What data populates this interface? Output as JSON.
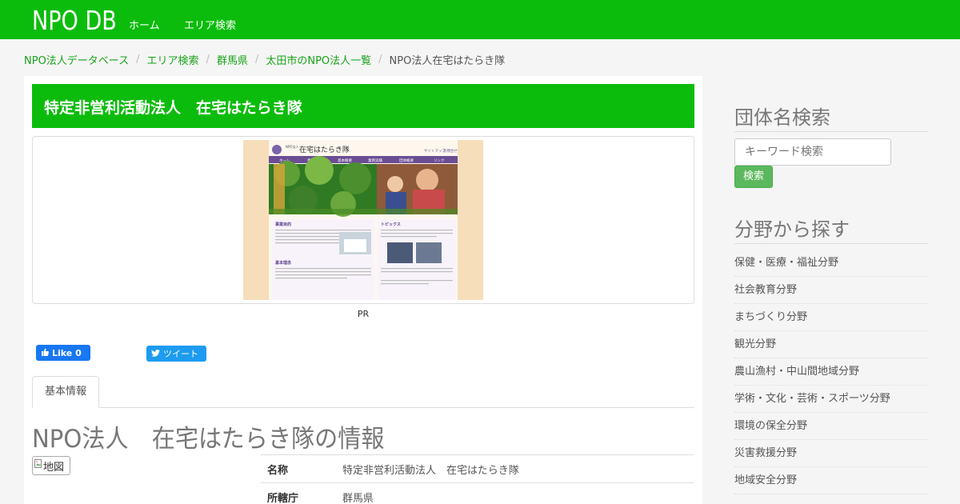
{
  "navbar": {
    "brand": "NPO DB",
    "links": [
      "ホーム",
      "エリア検索"
    ]
  },
  "breadcrumb": {
    "items": [
      "NPO法人データベース",
      "エリア検索",
      "群馬県",
      "太田市のNPO法人一覧"
    ],
    "separator": "/",
    "current": "NPO法人在宅はたらき隊"
  },
  "main": {
    "title": "特定非営利活動法人　在宅はたらき隊",
    "pr_label": "PR",
    "screenshot": {
      "logo_text": "在宅はたらき隊",
      "header_links": [
        "サイトマップ",
        "お問合せ"
      ],
      "nav": [
        "ホーム",
        "事業目的",
        "基本概要",
        "業務実績",
        "団体概要",
        "リンク"
      ],
      "section_left_1": "事業目的",
      "section_left_2": "基本理念",
      "section_right": "トピックス"
    },
    "social": {
      "like_label": "Like 0",
      "tweet_label": "ツイート"
    },
    "tabs": [
      "基本情報"
    ],
    "info_heading": "NPO法人　在宅はたらき隊の情報",
    "map_alt": "地図",
    "info_rows": [
      {
        "label": "名称",
        "value": "特定非営利活動法人　在宅はたらき隊"
      },
      {
        "label": "所轄庁",
        "value": "群馬県"
      }
    ]
  },
  "sidebar": {
    "search_heading": "団体名検索",
    "search_placeholder": "キーワード検索",
    "search_button": "検索",
    "category_heading": "分野から探す",
    "categories": [
      "保健・医療・福祉分野",
      "社会教育分野",
      "まちづくり分野",
      "観光分野",
      "農山漁村・中山間地域分野",
      "学術・文化・芸術・スポーツ分野",
      "環境の保全分野",
      "災害救援分野",
      "地域安全分野"
    ]
  },
  "colors": {
    "brand_green": "#0cbc0c",
    "link_green": "#18a318",
    "button_green": "#5cb85c",
    "facebook_blue": "#1877f2",
    "twitter_blue": "#1d9bf0"
  }
}
